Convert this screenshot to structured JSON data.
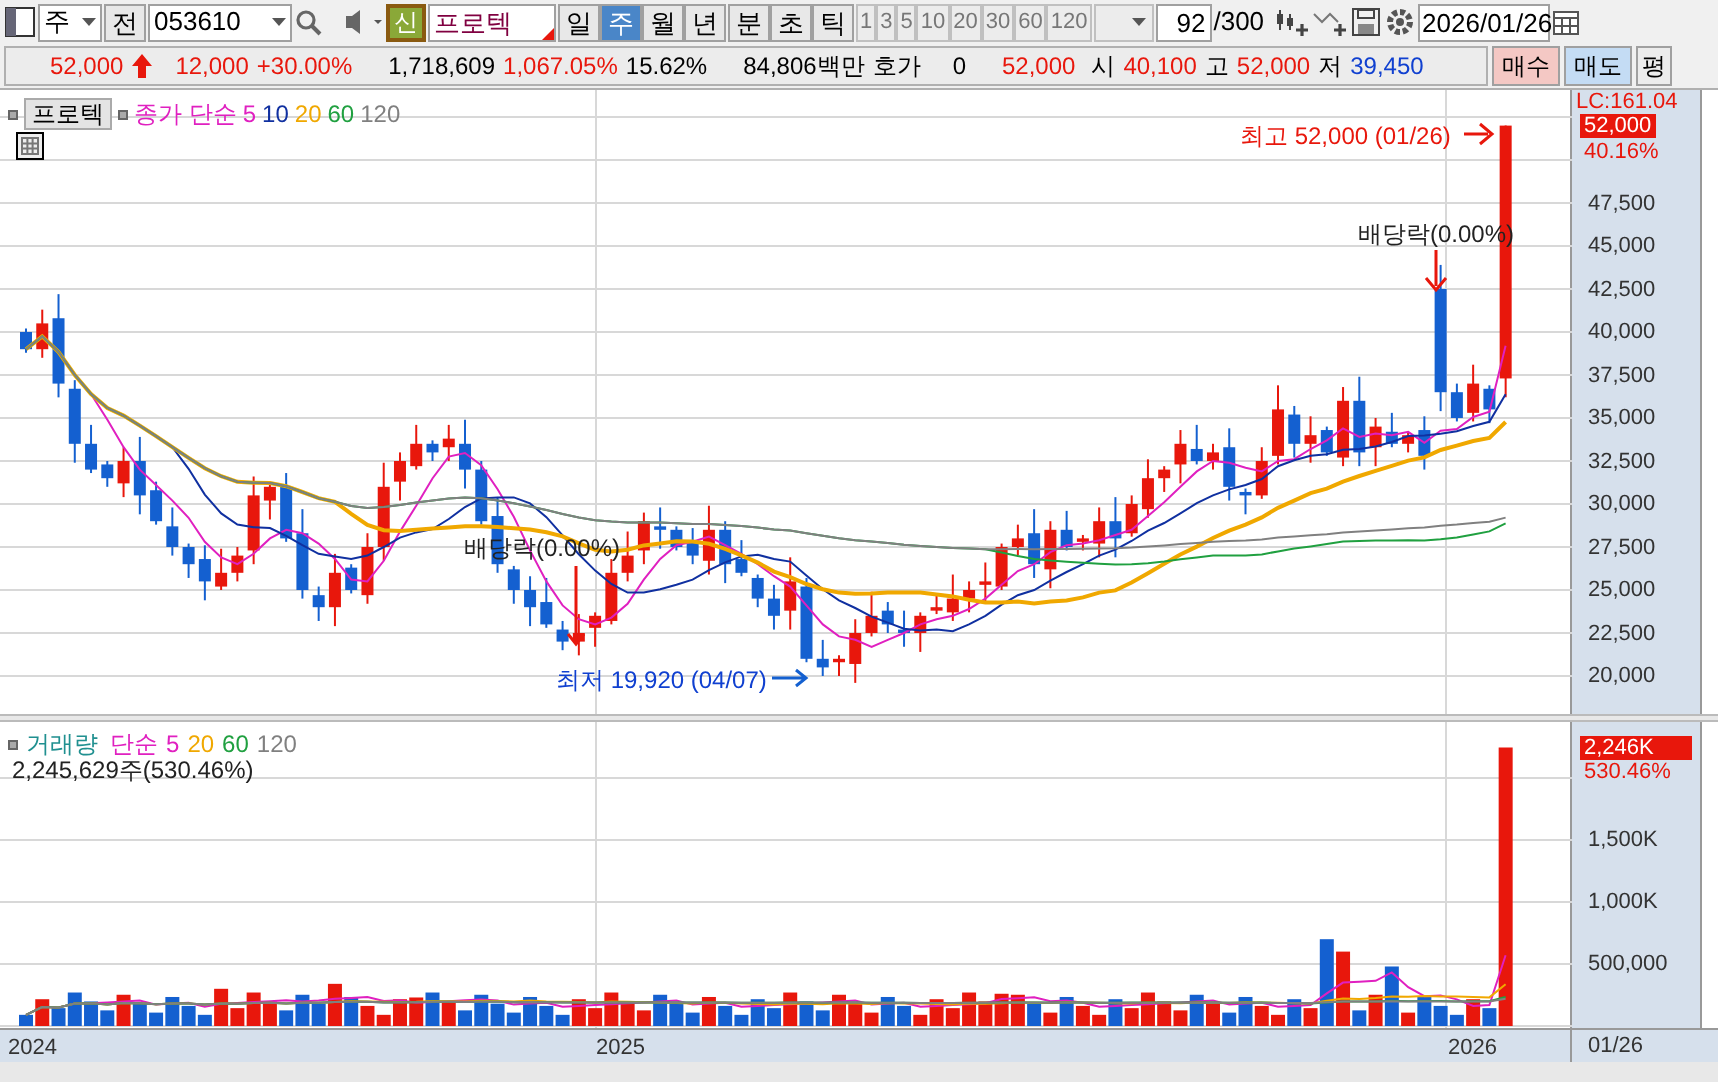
{
  "toolbar": {
    "market": "주",
    "prev_button": "전",
    "code": "053610",
    "new_badge": "신",
    "stock_name": "프로텍",
    "periods": [
      {
        "label": "일",
        "selected": false
      },
      {
        "label": "주",
        "selected": true
      },
      {
        "label": "월",
        "selected": false
      },
      {
        "label": "년",
        "selected": false
      }
    ],
    "sub_periods": [
      {
        "label": "분",
        "selected": false
      },
      {
        "label": "초",
        "selected": false
      },
      {
        "label": "틱",
        "selected": false
      }
    ],
    "intervals": [
      "1",
      "3",
      "5",
      "10",
      "20",
      "30",
      "60",
      "120"
    ],
    "count": "92",
    "count_max": "/300",
    "date": "2026/01/26"
  },
  "quote": {
    "price": "52,000",
    "change": "12,000",
    "change_rate": "+30.00%",
    "volume": "1,718,609",
    "volume_rate": "1,067.05%",
    "turnover_rate": "15.62%",
    "amount": "84,806백만",
    "ask_label": "호가",
    "ask_value": "0",
    "ask_price": "52,000",
    "open_label": "시",
    "open": "40,100",
    "high_label": "고",
    "high": "52,000",
    "low_label": "저",
    "low": "39,450",
    "buy": "매수",
    "sell": "매도",
    "eval": "평"
  },
  "price_chart": {
    "name_tag": "프로텍",
    "indicator_label": "종가 단순",
    "ma_periods": [
      {
        "label": "5",
        "color": "#e020c0"
      },
      {
        "label": "10",
        "color": "#1030a0"
      },
      {
        "label": "20",
        "color": "#f0a800"
      },
      {
        "label": "60",
        "color": "#20a040"
      },
      {
        "label": "120",
        "color": "#808080"
      }
    ],
    "high_note": "최고 52,000 (01/26)",
    "low_note": "최저 19,920 (04/07)",
    "dividend_notes": [
      "배당락(0.00%)",
      "배당락(0.00%)"
    ],
    "lc_label": "LC:161.04",
    "last_price": "52,000",
    "last_change": "40.16%",
    "y_labels": [
      "47,500",
      "45,000",
      "42,500",
      "40,000",
      "37,500",
      "35,000",
      "32,500",
      "30,000",
      "27,500",
      "25,000",
      "22,500",
      "20,000"
    ]
  },
  "volume_chart": {
    "label": "거래량",
    "indicator_label": "단순",
    "ma_periods": [
      {
        "label": "5",
        "color": "#e020c0"
      },
      {
        "label": "20",
        "color": "#f0a800"
      },
      {
        "label": "60",
        "color": "#20a040"
      },
      {
        "label": "120",
        "color": "#808080"
      }
    ],
    "current": "2,245,629주(530.46%)",
    "last_volume": "2,246K",
    "last_rate": "530.46%",
    "y_labels": [
      "1,500K",
      "1,000K",
      "500,000"
    ]
  },
  "x_axis": {
    "labels": [
      "2024",
      "2025",
      "2026"
    ],
    "cursor_date": "01/26"
  }
}
